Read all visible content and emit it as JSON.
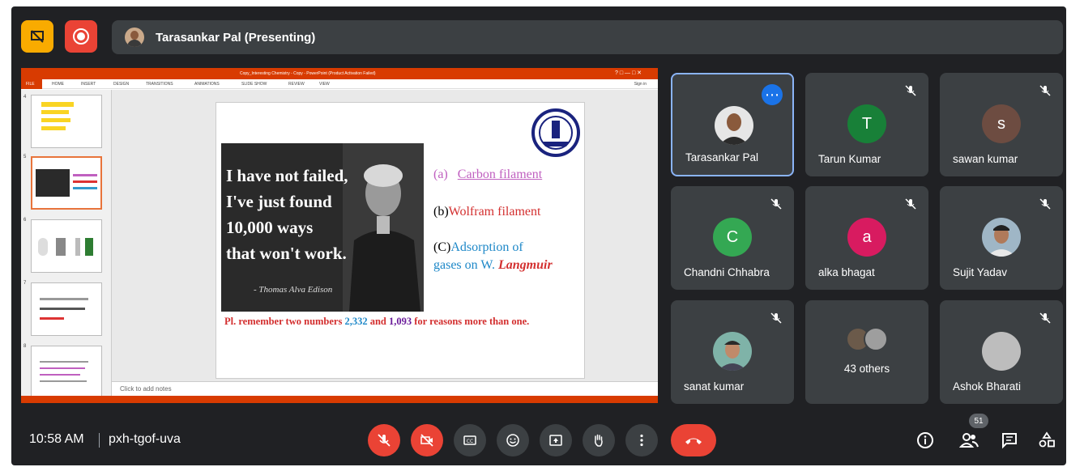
{
  "presenter_bar": {
    "label": "Tarasankar Pal (Presenting)"
  },
  "powerpoint": {
    "window_title": "Copy_Interesting Chemistry - Copy - PowerPoint (Product Activation Failed)",
    "ribbon_tabs": [
      "FILE",
      "HOME",
      "INSERT",
      "DESIGN",
      "TRANSITIONS",
      "ANIMATIONS",
      "SLIDE SHOW",
      "REVIEW",
      "VIEW"
    ],
    "sign_in": "Sign in",
    "thumbnail_numbers": [
      "4",
      "5",
      "6",
      "7",
      "8"
    ],
    "notes_placeholder": "Click to add notes"
  },
  "slide": {
    "quote_lines": [
      "I have not failed,",
      "I've just found",
      "10,000 ways",
      "that won't work."
    ],
    "quote_signature": "- Thomas Alva Edison",
    "option_a_prefix": "(a)",
    "option_a": "Carbon filament",
    "option_b_prefix": "(b)",
    "option_b": "Wolfram filament",
    "option_c_prefix": "(C)",
    "option_c_line1": "Adsorption of",
    "option_c_line2": "gases on W.",
    "option_c_name": "Langmuir",
    "note_prefix": "Pl. remember two numbers",
    "note_num1": "2,332",
    "note_and": "and",
    "note_num2": "1,093",
    "note_suffix": "for reasons more than one."
  },
  "participants": [
    {
      "name": "Tarasankar Pal",
      "type": "photo"
    },
    {
      "name": "Tarun Kumar",
      "initial": "T",
      "color": "#188038"
    },
    {
      "name": "sawan kumar",
      "initial": "s",
      "color": "#6d4c41"
    },
    {
      "name": "Chandni Chhabra",
      "initial": "C",
      "color": "#34a853"
    },
    {
      "name": "alka bhagat",
      "initial": "a",
      "color": "#d81b60"
    },
    {
      "name": "Sujit Yadav",
      "type": "photo"
    },
    {
      "name": "sanat kumar",
      "type": "photo"
    },
    {
      "name": "43 others",
      "type": "group"
    },
    {
      "name": "Ashok Bharati",
      "type": "photo"
    }
  ],
  "bottom": {
    "time": "10:58 AM",
    "meeting_code": "pxh-tgof-uva",
    "people_count": "51"
  },
  "colors": {
    "meet_bg": "#202124",
    "tile_bg": "#3c4043",
    "danger": "#ea4335",
    "accent": "#8ab4f8"
  }
}
